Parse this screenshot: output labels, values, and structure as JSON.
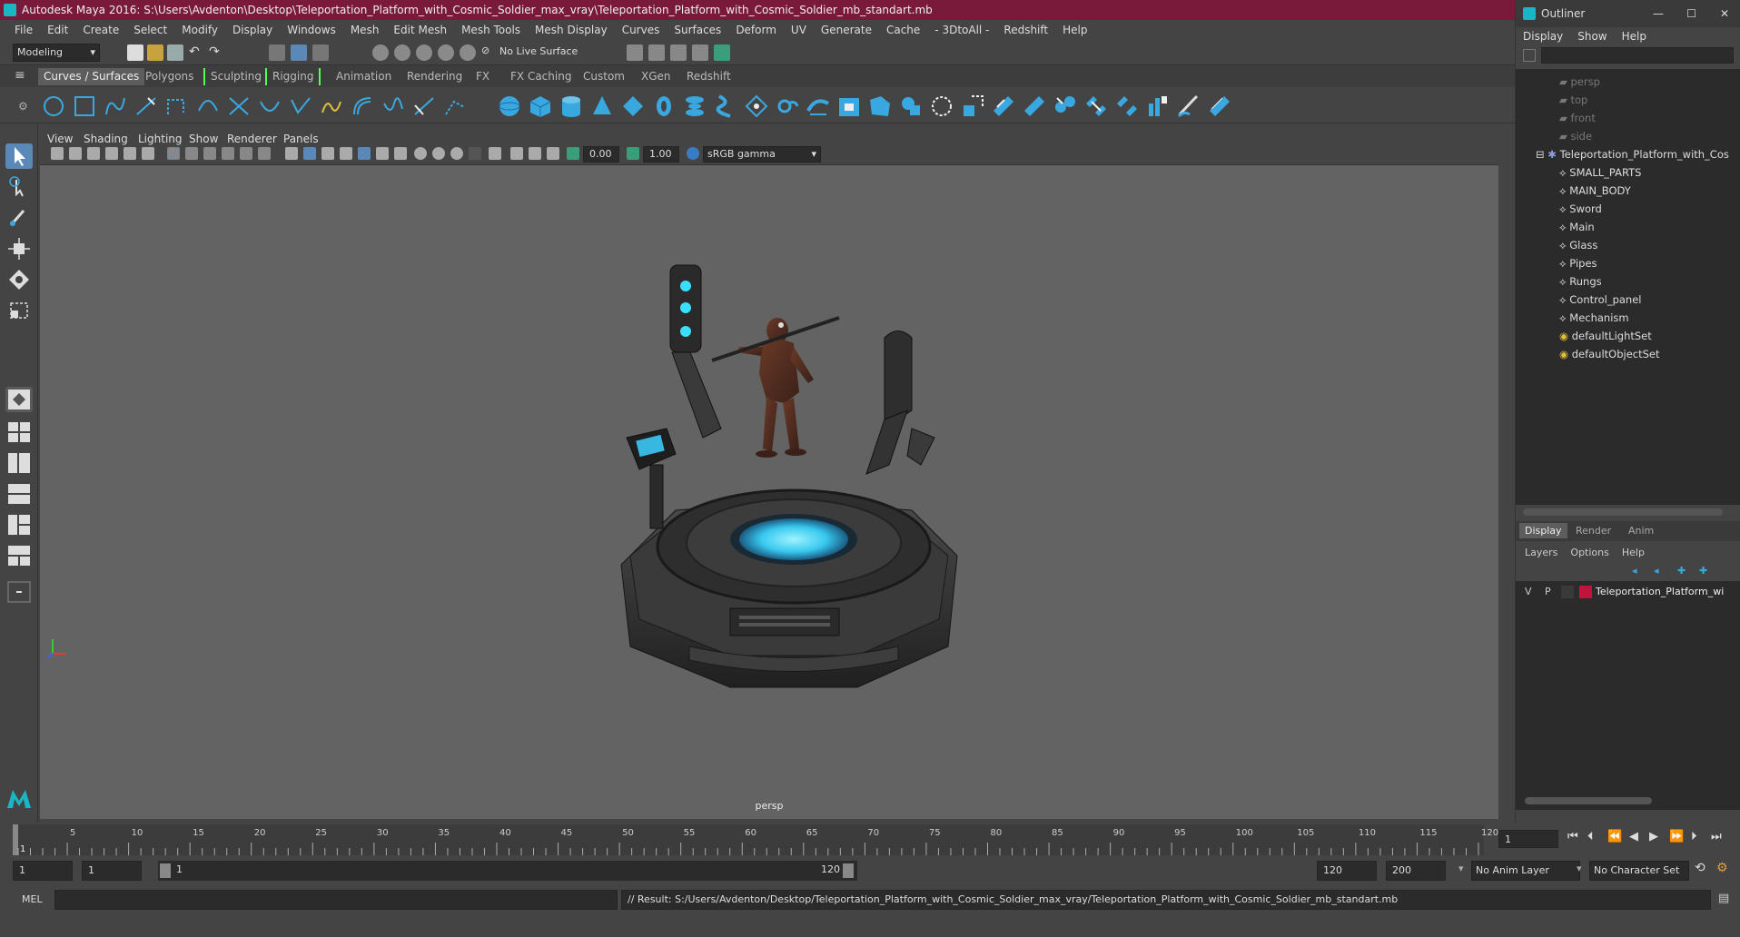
{
  "window": {
    "title": "Autodesk Maya 2016: S:\\Users\\Avdenton\\Desktop\\Teleportation_Platform_with_Cosmic_Soldier_max_vray\\Teleportation_Platform_with_Cosmic_Soldier_mb_standart.mb"
  },
  "menubar": [
    "File",
    "Edit",
    "Create",
    "Select",
    "Modify",
    "Display",
    "Windows",
    "Mesh",
    "Edit Mesh",
    "Mesh Tools",
    "Mesh Display",
    "Curves",
    "Surfaces",
    "Deform",
    "UV",
    "Generate",
    "Cache",
    "- 3DtoAll -",
    "Redshift",
    "Help"
  ],
  "statusline": {
    "mode": "Modeling",
    "live_surface": "No Live Surface"
  },
  "shelf_tabs": [
    "Curves / Surfaces",
    "Polygons",
    "Sculpting",
    "Rigging",
    "Animation",
    "Rendering",
    "FX",
    "FX Caching",
    "Custom",
    "XGen",
    "Redshift"
  ],
  "shelf_active": "Curves / Surfaces",
  "viewport": {
    "menus": [
      "View",
      "Shading",
      "Lighting",
      "Show",
      "Renderer",
      "Panels"
    ],
    "exposure": "0.00",
    "gamma": "1.00",
    "color_space": "sRGB gamma",
    "camera_label": "persp"
  },
  "outliner": {
    "title": "Outliner",
    "menus": [
      "Display",
      "Show",
      "Help"
    ],
    "cameras": [
      "persp",
      "top",
      "front",
      "side"
    ],
    "root": "Teleportation_Platform_with_Cos",
    "children": [
      "SMALL_PARTS",
      "MAIN_BODY",
      "Sword",
      "Main",
      "Glass",
      "Pipes",
      "Rungs",
      "Control_panel",
      "Mechanism"
    ],
    "sets": [
      "defaultLightSet",
      "defaultObjectSet"
    ]
  },
  "layer_editor": {
    "tabs": [
      "Display",
      "Render",
      "Anim"
    ],
    "menus": [
      "Layers",
      "Options",
      "Help"
    ],
    "layer": {
      "v": "V",
      "p": "P",
      "name": "Teleportation_Platform_wi",
      "color": "#c0143c"
    }
  },
  "timeline": {
    "ticks": [
      "5",
      "10",
      "15",
      "20",
      "25",
      "30",
      "35",
      "40",
      "45",
      "50",
      "55",
      "60",
      "65",
      "70",
      "75",
      "80",
      "85",
      "90",
      "95",
      "100",
      "105",
      "110",
      "115",
      "120"
    ],
    "start_marker": "1",
    "current_frame": "1"
  },
  "range": {
    "start": "1",
    "playback_start": "1",
    "range_start_label": "1",
    "range_end_label": "120",
    "playback_end": "120",
    "end": "200",
    "anim_layer": "No Anim Layer",
    "character_set": "No Character Set"
  },
  "command": {
    "lang": "MEL",
    "result": "// Result: S:/Users/Avdenton/Desktop/Teleportation_Platform_with_Cosmic_Soldier_max_vray/Teleportation_Platform_with_Cosmic_Soldier_mb_standart.mb"
  },
  "colors": {
    "title_bg": "#7a1a3a",
    "accent_blue": "#3aa8e0",
    "glow_cyan": "#38e0ff"
  }
}
